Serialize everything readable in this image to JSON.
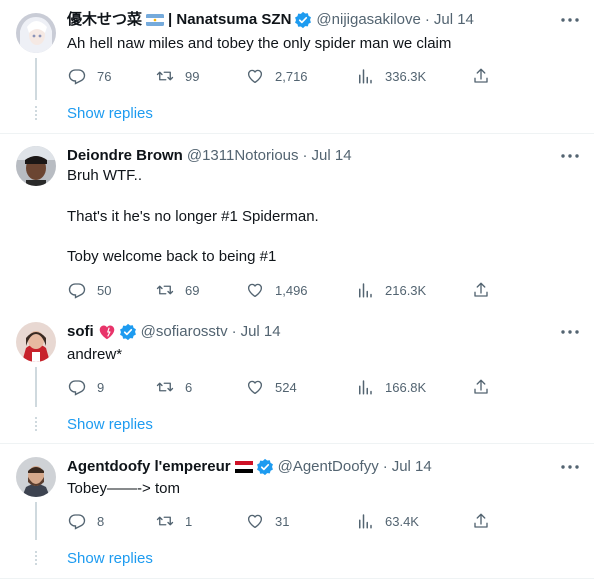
{
  "tweets": [
    {
      "name": "優木せつ菜",
      "name_suffix": "| Nanatsuma SZN",
      "handle": "@nijigasakilove",
      "date": "Jul 14",
      "text_lines": [
        "Ah hell naw miles and tobey the only spider man we claim"
      ],
      "replies": "76",
      "retweets": "99",
      "likes": "2,716",
      "views": "336.3K",
      "verified": true,
      "flag_icon": "argentina-flag-icon",
      "show_replies": "Show replies"
    },
    {
      "name": "Deiondre Brown",
      "handle": "@1311Notorious",
      "date": "Jul 14",
      "text_lines": [
        "Bruh WTF..",
        "",
        "That's it he's no longer #1 Spiderman.",
        "",
        "Toby welcome  back to being #1"
      ],
      "replies": "50",
      "retweets": "69",
      "likes": "1,496",
      "views": "216.3K",
      "verified": false
    },
    {
      "name": "sofi",
      "handle": "@sofiarosstv",
      "date": "Jul 14",
      "text_lines": [
        "andrew*"
      ],
      "replies": "9",
      "retweets": "6",
      "likes": "524",
      "views": "166.8K",
      "verified": true,
      "name_icon": "heart-emoji-icon",
      "show_replies": "Show replies"
    },
    {
      "name": "Agentdoofy l'empereur",
      "handle": "@AgentDoofyy",
      "date": "Jul 14",
      "text_lines": [
        "Tobey——-> tom"
      ],
      "replies": "8",
      "retweets": "1",
      "likes": "31",
      "views": "63.4K",
      "verified": true,
      "flag_icon": "yemen-flag-icon",
      "show_replies": "Show replies"
    }
  ],
  "separator": "·",
  "colors": {
    "text": "#0f1419",
    "secondary": "#536471",
    "link": "#1d9bf0",
    "verified": "#1d9bf0",
    "divider": "#eff3f4"
  }
}
